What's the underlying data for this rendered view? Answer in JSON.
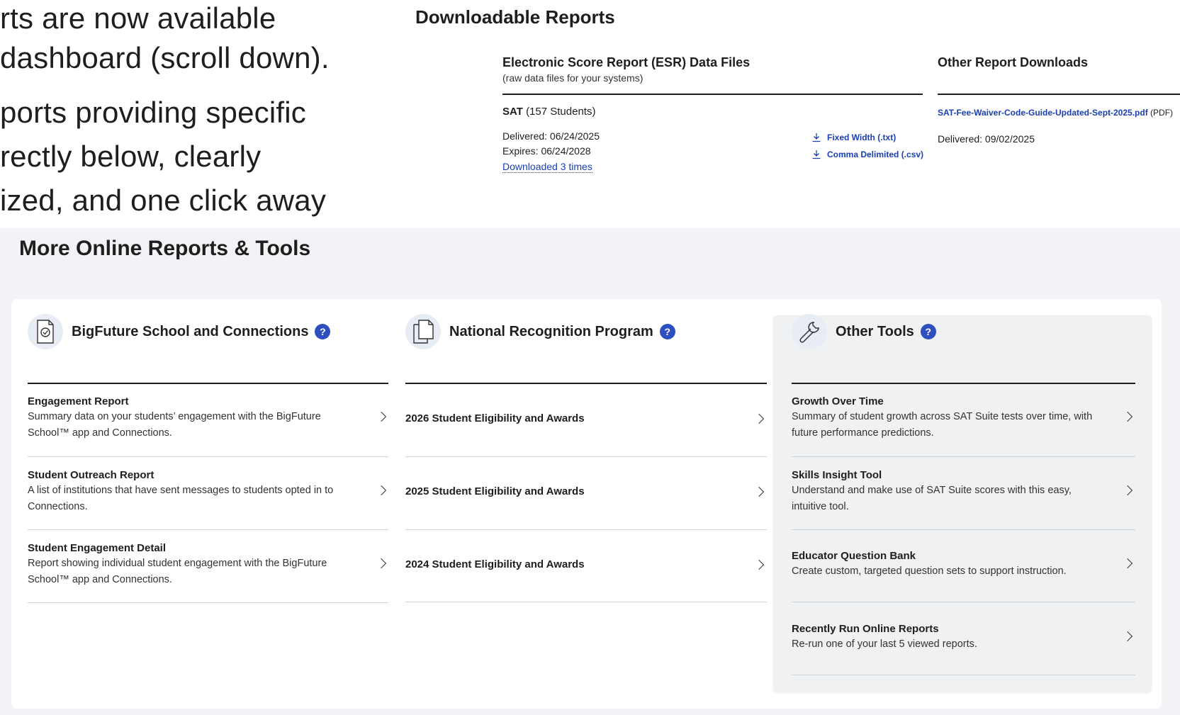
{
  "intro": {
    "lines": [
      "rts are now available",
      " dashboard (scroll down).",
      "ports providing specific",
      "rectly below, clearly",
      "ized, and one click away"
    ]
  },
  "downloadable": {
    "title": "Downloadable Reports",
    "esr": {
      "title": "Electronic Score Report (ESR) Data Files",
      "subtitle": "(raw data files for your systems)",
      "test_name": "SAT",
      "student_count": "(157 Students)",
      "delivered": "Delivered: 06/24/2025",
      "expires": "Expires: 06/24/2028",
      "downloaded": "Downloaded 3 times",
      "fixed_width": "Fixed Width (.txt)",
      "comma_delimited": "Comma Delimited (.csv)"
    },
    "other": {
      "title": "Other Report Downloads",
      "pdf_name": "SAT-Fee-Waiver-Code-Guide-Updated-Sept-2025.pdf",
      "pdf_suffix": " (PDF)",
      "delivered": "Delivered: 09/02/2025"
    }
  },
  "more": {
    "title": "More Online Reports & Tools",
    "columns": [
      {
        "title": "BigFuture School and Connections",
        "icon": "document-check-icon",
        "items": [
          {
            "title": "Engagement Report",
            "desc": "Summary data on your students’ engagement with the BigFuture School™ app and Connections."
          },
          {
            "title": "Student Outreach Report",
            "desc": "A list of institutions that have sent messages to students opted in to Connections."
          },
          {
            "title": "Student Engagement Detail",
            "desc": "Report showing individual student engagement with the BigFuture School™ app and Connections."
          }
        ]
      },
      {
        "title": "National Recognition Program",
        "icon": "documents-icon",
        "items": [
          {
            "title": "2026 Student Eligibility and Awards"
          },
          {
            "title": "2025 Student Eligibility and Awards"
          },
          {
            "title": "2024 Student Eligibility and Awards"
          }
        ]
      },
      {
        "title": "Other Tools",
        "icon": "wrench-icon",
        "items": [
          {
            "title": "Growth Over Time",
            "desc": "Summary of student growth across SAT Suite tests over time, with future performance predictions."
          },
          {
            "title": "Skills Insight Tool",
            "desc": "Understand and make use of SAT Suite scores with this easy, intuitive tool."
          },
          {
            "title": "Educator Question Bank",
            "desc": "Create custom, targeted question sets to support instruction."
          },
          {
            "title": "Recently Run Online Reports",
            "desc": "Re-run one of your last 5 viewed reports."
          }
        ]
      }
    ]
  },
  "colors": {
    "link": "#1a3fb0",
    "help_badge": "#2d4fc0",
    "section_bg": "#f1f3f6"
  }
}
